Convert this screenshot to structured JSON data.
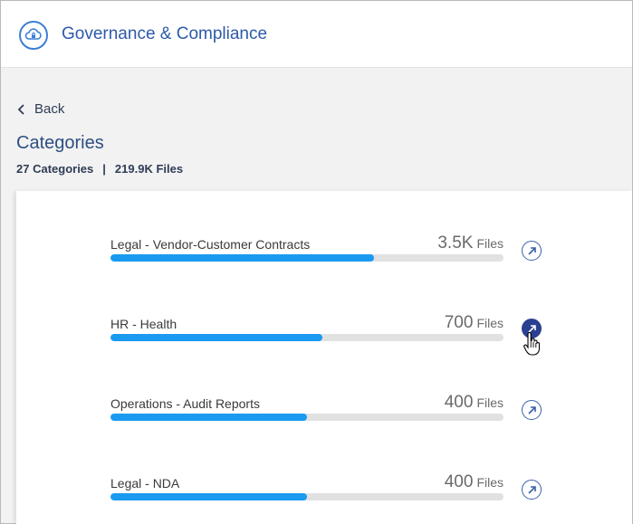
{
  "header": {
    "title": "Governance & Compliance",
    "icon": "cloud-lock-icon"
  },
  "nav": {
    "back_label": "Back"
  },
  "page": {
    "title": "Categories",
    "categories_count": "27 Categories",
    "separator": "|",
    "files_count": "219.9K Files"
  },
  "categories": [
    {
      "label": "Legal - Vendor-Customer Contracts",
      "count": "3.5K",
      "unit": "Files",
      "fill": 0.67,
      "active": false
    },
    {
      "label": "HR - Health",
      "count": "700",
      "unit": "Files",
      "fill": 0.54,
      "active": true
    },
    {
      "label": "Operations - Audit Reports",
      "count": "400",
      "unit": "Files",
      "fill": 0.5,
      "active": false
    },
    {
      "label": "Legal - NDA",
      "count": "400",
      "unit": "Files",
      "fill": 0.5,
      "active": false
    }
  ],
  "colors": {
    "accent": "#1a9af0",
    "title": "#2d5aa8",
    "active_button": "#2a3f8f"
  }
}
